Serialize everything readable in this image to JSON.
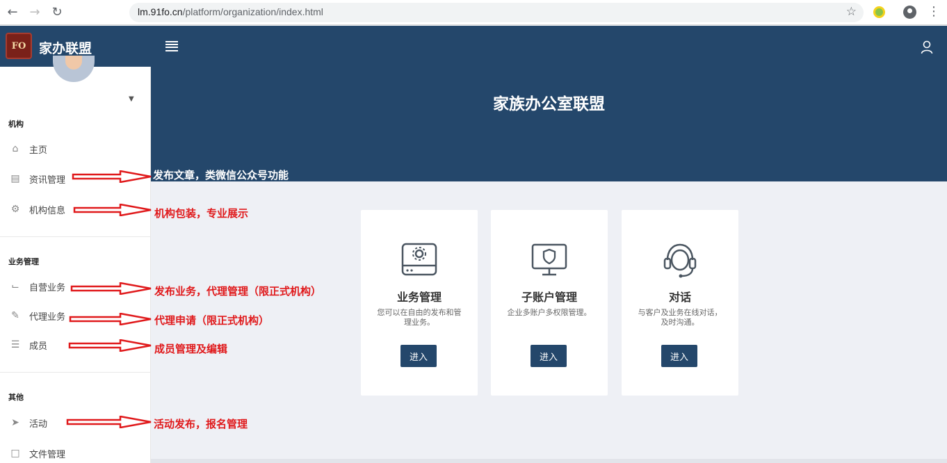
{
  "browser": {
    "url_host": "lm.91fo.cn",
    "url_path": "/platform/organization/index.html"
  },
  "header": {
    "logo_text": "FO",
    "brand": "家办联盟"
  },
  "sidebar": {
    "sections": [
      {
        "title": "机构",
        "items": [
          {
            "label": "主页",
            "icon": "home-icon"
          },
          {
            "label": "资讯管理",
            "icon": "document-icon"
          },
          {
            "label": "机构信息",
            "icon": "gear-icon"
          }
        ]
      },
      {
        "title": "业务管理",
        "items": [
          {
            "label": "自营业务",
            "icon": "boot-icon"
          },
          {
            "label": "代理业务",
            "icon": "pencil-icon"
          },
          {
            "label": "成员",
            "icon": "list-icon"
          }
        ]
      },
      {
        "title": "其他",
        "items": [
          {
            "label": "活动",
            "icon": "paper-plane-icon"
          },
          {
            "label": "文件管理",
            "icon": "folder-icon"
          }
        ]
      }
    ]
  },
  "hero": {
    "title": "家族办公室联盟"
  },
  "cards": [
    {
      "title": "业务管理",
      "desc": "您可以在自由的发布和管理业务。",
      "button": "进入",
      "icon": "hard-drive-gear-icon"
    },
    {
      "title": "子账户管理",
      "desc": "企业多账户多权限管理。",
      "button": "进入",
      "icon": "monitor-shield-icon"
    },
    {
      "title": "对话",
      "desc": "与客户及业务在线对话，及时沟通。",
      "button": "进入",
      "icon": "headset-icon"
    }
  ],
  "annotations": [
    "发布文章，类微信公众号功能",
    "机构包装，专业展示",
    "发布业务，代理管理（限正式机构）",
    "代理申请（限正式机构）",
    "成员管理及编辑",
    "活动发布，报名管理"
  ],
  "colors": {
    "header_bg": "#24476b",
    "content_bg": "#eef0f5",
    "annotation": "#e0191b"
  }
}
